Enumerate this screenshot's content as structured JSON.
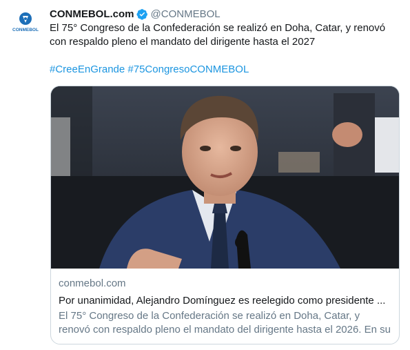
{
  "tweet": {
    "display_name": "CONMEBOL.com",
    "handle": "@CONMEBOL",
    "avatar_text": "CONMEBOL",
    "text": "El 75° Congreso de la Confederación se realizó en Doha, Catar, y renovó con respaldo pleno el mandato del dirigente hasta el 2027",
    "hashtags": [
      "#CreeEnGrande",
      "#75CongresoCONMEBOL"
    ]
  },
  "card": {
    "domain": "conmebol.com",
    "title": "Por unanimidad, Alejandro Domínguez es reelegido como presidente ...",
    "description": "El 75° Congreso de la Confederación se realizó en Doha, Catar, y renovó con respaldo pleno el mandato del dirigente hasta el 2026. En su ..."
  },
  "colors": {
    "link": "#1b95e0",
    "brand": "#1d6fb8",
    "verified": "#1da1f2"
  },
  "icons": {
    "verified": "verified-badge-icon",
    "avatar": "conmebol-logo"
  }
}
